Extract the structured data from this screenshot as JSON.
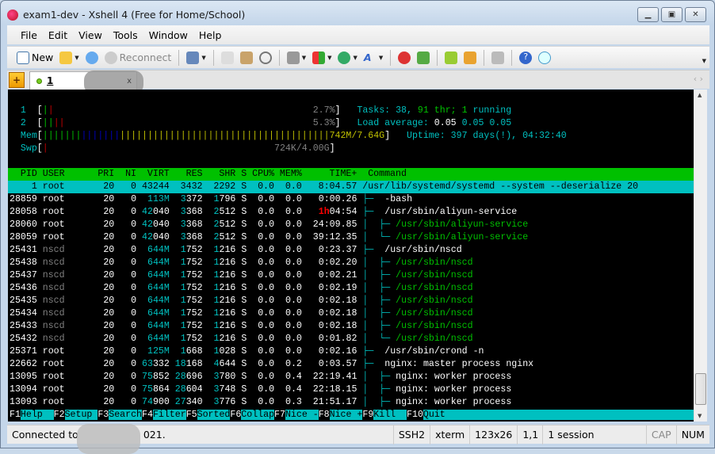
{
  "window": {
    "title": "exam1-dev - Xshell 4 (Free for Home/School)",
    "controls": [
      "minimize",
      "maximize",
      "close"
    ]
  },
  "menu": [
    "File",
    "Edit",
    "View",
    "Tools",
    "Window",
    "Help"
  ],
  "toolbar": {
    "new_label": "New",
    "reconnect_label": "Reconnect"
  },
  "tab": {
    "label": "1",
    "close": "x"
  },
  "htop": {
    "cpu1": {
      "label": "1",
      "value": "2.7%"
    },
    "cpu2": {
      "label": "2",
      "value": "5.3%"
    },
    "mem": {
      "label": "Mem",
      "value": "742M/7.64G"
    },
    "swp": {
      "label": "Swp",
      "value": "724K/4.00G"
    },
    "tasks": {
      "label": "Tasks:",
      "tasks": "38",
      "thr": "91",
      "thr_label": "thr;",
      "running": "1",
      "running_label": "running"
    },
    "load": {
      "label": "Load average:",
      "l1": "0.05",
      "l5": "0.05",
      "l15": "0.05"
    },
    "uptime": {
      "label": "Uptime:",
      "value": "397 days(!), 04:32:40"
    },
    "header": [
      "PID",
      "USER",
      "PRI",
      "NI",
      "VIRT",
      "RES",
      "SHR",
      "S",
      "CPU%",
      "MEM%",
      "TIME+",
      "Command"
    ],
    "rows": [
      {
        "pid": "1",
        "user": "root",
        "pri": "20",
        "ni": "0",
        "virt": "43244",
        "res": "3432",
        "shr": "2292",
        "s": "S",
        "cpu": "0.0",
        "mem": "0.0",
        "time": "8:04.57",
        "tree": "",
        "cmd": "/usr/lib/systemd/systemd --system --deserialize 20",
        "selected": true
      },
      {
        "pid": "28859",
        "user": "root",
        "pri": "20",
        "ni": "0",
        "virt": "113M",
        "res": "3372",
        "shr": "1796",
        "s": "S",
        "cpu": "0.0",
        "mem": "0.0",
        "time": "0:00.26",
        "tree": "├─  ",
        "cmd": "-bash"
      },
      {
        "pid": "28058",
        "user": "root",
        "pri": "20",
        "ni": "0",
        "virt": "42040",
        "res": "3368",
        "shr": "2512",
        "s": "S",
        "cpu": "0.0",
        "mem": "0.0",
        "time": "1h04:54",
        "tree": "├─  ",
        "cmd": "/usr/sbin/aliyun-service"
      },
      {
        "pid": "28060",
        "user": "root",
        "pri": "20",
        "ni": "0",
        "virt": "42040",
        "res": "3368",
        "shr": "2512",
        "s": "S",
        "cpu": "0.0",
        "mem": "0.0",
        "time": "24:09.85",
        "tree": "│  ├─ ",
        "cmd": "/usr/sbin/aliyun-service",
        "thread": true
      },
      {
        "pid": "28059",
        "user": "root",
        "pri": "20",
        "ni": "0",
        "virt": "42040",
        "res": "3368",
        "shr": "2512",
        "s": "S",
        "cpu": "0.0",
        "mem": "0.0",
        "time": "39:12.35",
        "tree": "│  └─ ",
        "cmd": "/usr/sbin/aliyun-service",
        "thread": true
      },
      {
        "pid": "25431",
        "user": "nscd",
        "pri": "20",
        "ni": "0",
        "virt": "644M",
        "res": "1752",
        "shr": "1216",
        "s": "S",
        "cpu": "0.0",
        "mem": "0.0",
        "time": "0:23.37",
        "tree": "├─  ",
        "cmd": "/usr/sbin/nscd"
      },
      {
        "pid": "25438",
        "user": "nscd",
        "pri": "20",
        "ni": "0",
        "virt": "644M",
        "res": "1752",
        "shr": "1216",
        "s": "S",
        "cpu": "0.0",
        "mem": "0.0",
        "time": "0:02.20",
        "tree": "│  ├─ ",
        "cmd": "/usr/sbin/nscd",
        "thread": true
      },
      {
        "pid": "25437",
        "user": "nscd",
        "pri": "20",
        "ni": "0",
        "virt": "644M",
        "res": "1752",
        "shr": "1216",
        "s": "S",
        "cpu": "0.0",
        "mem": "0.0",
        "time": "0:02.21",
        "tree": "│  ├─ ",
        "cmd": "/usr/sbin/nscd",
        "thread": true
      },
      {
        "pid": "25436",
        "user": "nscd",
        "pri": "20",
        "ni": "0",
        "virt": "644M",
        "res": "1752",
        "shr": "1216",
        "s": "S",
        "cpu": "0.0",
        "mem": "0.0",
        "time": "0:02.19",
        "tree": "│  ├─ ",
        "cmd": "/usr/sbin/nscd",
        "thread": true
      },
      {
        "pid": "25435",
        "user": "nscd",
        "pri": "20",
        "ni": "0",
        "virt": "644M",
        "res": "1752",
        "shr": "1216",
        "s": "S",
        "cpu": "0.0",
        "mem": "0.0",
        "time": "0:02.18",
        "tree": "│  ├─ ",
        "cmd": "/usr/sbin/nscd",
        "thread": true
      },
      {
        "pid": "25434",
        "user": "nscd",
        "pri": "20",
        "ni": "0",
        "virt": "644M",
        "res": "1752",
        "shr": "1216",
        "s": "S",
        "cpu": "0.0",
        "mem": "0.0",
        "time": "0:02.18",
        "tree": "│  ├─ ",
        "cmd": "/usr/sbin/nscd",
        "thread": true
      },
      {
        "pid": "25433",
        "user": "nscd",
        "pri": "20",
        "ni": "0",
        "virt": "644M",
        "res": "1752",
        "shr": "1216",
        "s": "S",
        "cpu": "0.0",
        "mem": "0.0",
        "time": "0:02.18",
        "tree": "│  ├─ ",
        "cmd": "/usr/sbin/nscd",
        "thread": true
      },
      {
        "pid": "25432",
        "user": "nscd",
        "pri": "20",
        "ni": "0",
        "virt": "644M",
        "res": "1752",
        "shr": "1216",
        "s": "S",
        "cpu": "0.0",
        "mem": "0.0",
        "time": "0:01.82",
        "tree": "│  └─ ",
        "cmd": "/usr/sbin/nscd",
        "thread": true
      },
      {
        "pid": "25371",
        "user": "root",
        "pri": "20",
        "ni": "0",
        "virt": "125M",
        "res": "1668",
        "shr": "1028",
        "s": "S",
        "cpu": "0.0",
        "mem": "0.0",
        "time": "0:02.16",
        "tree": "├─  ",
        "cmd": "/usr/sbin/crond -n"
      },
      {
        "pid": "22662",
        "user": "root",
        "pri": "20",
        "ni": "0",
        "virt": "63332",
        "res": "18168",
        "shr": "4644",
        "s": "S",
        "cpu": "0.0",
        "mem": "0.2",
        "time": "0:03.57",
        "tree": "├─  ",
        "cmd": "nginx: master process nginx"
      },
      {
        "pid": "13095",
        "user": "root",
        "pri": "20",
        "ni": "0",
        "virt": "75852",
        "res": "28696",
        "shr": "3780",
        "s": "S",
        "cpu": "0.0",
        "mem": "0.4",
        "time": "22:19.41",
        "tree": "│  ├─ ",
        "cmd": "nginx: worker process"
      },
      {
        "pid": "13094",
        "user": "root",
        "pri": "20",
        "ni": "0",
        "virt": "75864",
        "res": "28604",
        "shr": "3748",
        "s": "S",
        "cpu": "0.0",
        "mem": "0.4",
        "time": "22:18.15",
        "tree": "│  ├─ ",
        "cmd": "nginx: worker process"
      },
      {
        "pid": "13093",
        "user": "root",
        "pri": "20",
        "ni": "0",
        "virt": "74900",
        "res": "27340",
        "shr": "3776",
        "s": "S",
        "cpu": "0.0",
        "mem": "0.3",
        "time": "21:51.17",
        "tree": "│  ├─ ",
        "cmd": "nginx: worker process"
      }
    ],
    "fkeys": [
      {
        "k": "F1",
        "l": "Help  "
      },
      {
        "k": "F2",
        "l": "Setup "
      },
      {
        "k": "F3",
        "l": "Search"
      },
      {
        "k": "F4",
        "l": "Filter"
      },
      {
        "k": "F5",
        "l": "Sorted"
      },
      {
        "k": "F6",
        "l": "Collap"
      },
      {
        "k": "F7",
        "l": "Nice -"
      },
      {
        "k": "F8",
        "l": "Nice +"
      },
      {
        "k": "F9",
        "l": "Kill  "
      },
      {
        "k": "F10",
        "l": "Quit"
      }
    ]
  },
  "status": {
    "connected": "Connected to",
    "connected_tail": "021.",
    "protocol": "SSH2",
    "term": "xterm",
    "size": "123x26",
    "pos": "1,1",
    "sessions": "1 session",
    "cap": "CAP",
    "num": "NUM"
  }
}
